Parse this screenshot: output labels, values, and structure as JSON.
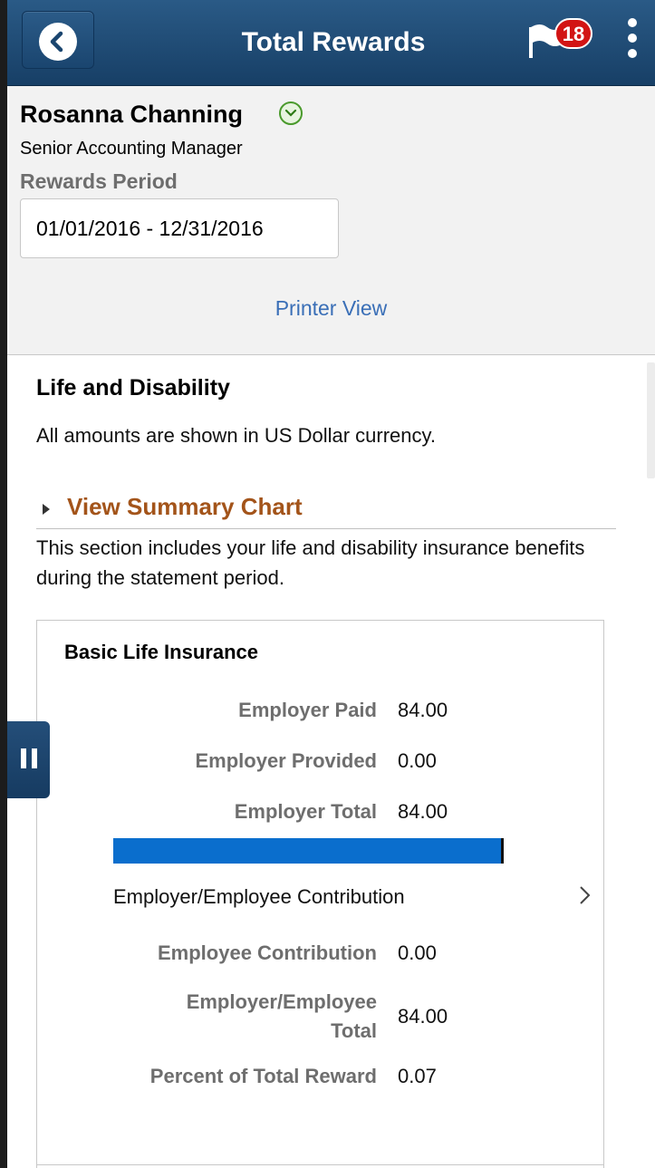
{
  "header": {
    "title": "Total Rewards",
    "notification_count": "18"
  },
  "profile": {
    "name": "Rosanna Channing",
    "job_title": "Senior Accounting Manager",
    "period_label": "Rewards Period",
    "period_value": "01/01/2016  - 12/31/2016",
    "printer_link": "Printer View"
  },
  "section": {
    "title": "Life and Disability",
    "currency_note": "All amounts are shown in US Dollar currency.",
    "summary_toggle": "View Summary Chart",
    "description": "This section includes your life and disability insurance benefits during the statement period."
  },
  "card": {
    "title": "Basic Life Insurance",
    "rows": [
      {
        "label": "Employer Paid",
        "value": "84.00"
      },
      {
        "label": "Employer Provided",
        "value": "0.00"
      },
      {
        "label": "Employer Total",
        "value": "84.00"
      }
    ],
    "contribution_bar": {
      "employer_fraction": 1.0,
      "employer_color": "#0a6ecd"
    },
    "bar_caption": "Employer/Employee Contribution",
    "rows2": [
      {
        "label": "Employee Contribution",
        "value": "0.00"
      },
      {
        "label_line1": "Employer/Employee",
        "label_line2": "Total",
        "value": "84.00"
      },
      {
        "label": "Percent of Total Reward",
        "value": "0.07"
      }
    ]
  },
  "colors": {
    "header": "#1f4a73",
    "link": "#3a6fb7",
    "toggle": "#a3541a",
    "badge": "#d21414"
  }
}
